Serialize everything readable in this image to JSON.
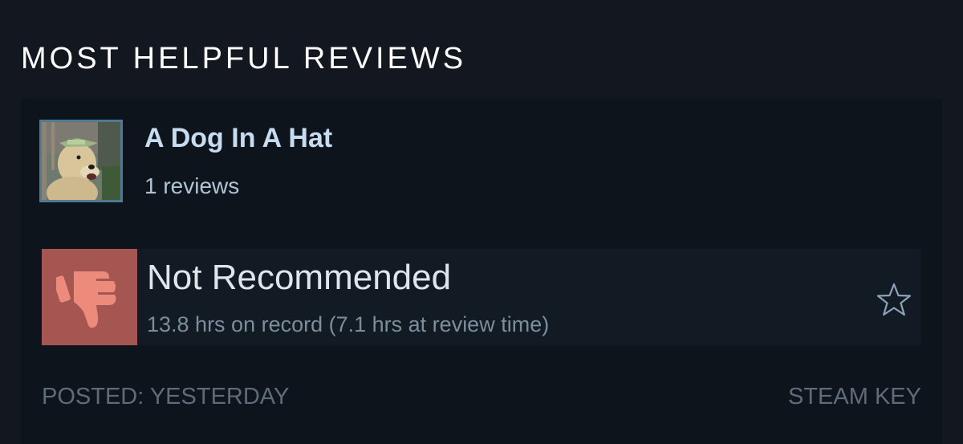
{
  "section": {
    "title": "MOST HELPFUL REVIEWS"
  },
  "review": {
    "author": {
      "name": "A Dog In A Hat",
      "review_count": "1 reviews",
      "avatar_icon": "dog-in-hat-avatar"
    },
    "verdict": {
      "label": "Not Recommended",
      "icon": "thumbs-down-icon",
      "color": "#a65651"
    },
    "playtime": "13.8 hrs on record (7.1 hrs at review time)",
    "favorite_icon": "star-outline-icon",
    "posted": "POSTED: YESTERDAY",
    "source": "STEAM KEY"
  },
  "colors": {
    "background": "#131720",
    "card": "#0e141c",
    "author_name": "#c7dcf0",
    "avatar_border": "#4f7a91"
  }
}
